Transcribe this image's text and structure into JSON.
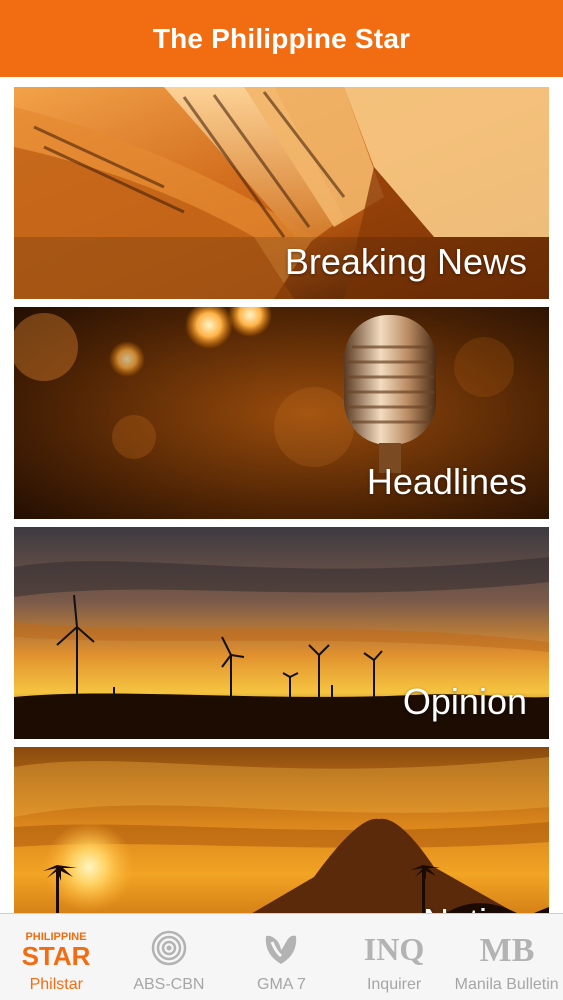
{
  "navbar": {
    "title": "The Philippine Star"
  },
  "sections": [
    {
      "label": "Breaking News"
    },
    {
      "label": "Headlines"
    },
    {
      "label": "Opinion"
    },
    {
      "label": "Nation"
    }
  ],
  "tabs": [
    {
      "label": "Philstar",
      "icon": "philstar-logo-icon",
      "logo_line1": "PHILIPPINE",
      "logo_line2": "STAR",
      "active": true
    },
    {
      "label": "ABS-CBN",
      "icon": "abs-cbn-logo-icon",
      "active": false
    },
    {
      "label": "GMA 7",
      "icon": "gma-heart-logo-icon",
      "active": false
    },
    {
      "label": "Inquirer",
      "icon": "inq-logo-icon",
      "logo_text": "INQ",
      "active": false
    },
    {
      "label": "Manila Bulletin",
      "icon": "mb-logo-icon",
      "logo_text": "MB",
      "active": false
    }
  ],
  "colors": {
    "accent": "#f26d12",
    "inactive": "#a6a6a6"
  }
}
